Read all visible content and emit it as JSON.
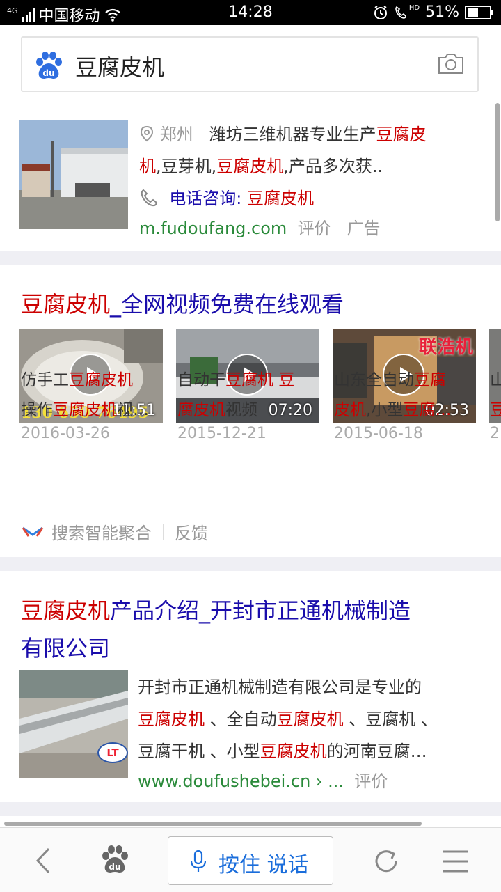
{
  "status_bar": {
    "network": "4G",
    "carrier": "中国移动",
    "time": "14:28",
    "hd": "HD",
    "battery": "51%",
    "battery_level": 0.51
  },
  "search": {
    "query": "豆腐皮机",
    "logo_text": "du"
  },
  "ad_card": {
    "location": "郑州",
    "desc_line1_plain": "潍坊三维机器专业生产",
    "desc_line1_red": "豆腐皮",
    "desc_line2_red1": "机",
    "desc_line2_plain1": ",豆芽机,",
    "desc_line2_red2": "豆腐皮机",
    "desc_line2_plain2": ",产品多次获..",
    "phone_label": "电话咨询:",
    "phone_keyword": "豆腐皮机",
    "url": "m.fudoufang.com",
    "rate": "评价",
    "ad_tag": "广告"
  },
  "video_card": {
    "title_red": "豆腐皮机",
    "title_rest": "_全网视频免费在线观看",
    "videos": [
      {
        "duration": "11:51",
        "t1a": "仿手工",
        "t1b": "豆腐皮机",
        "t2a": "操作",
        "t2b": "豆腐皮机",
        "t2c": "视…",
        "date": "2016-03-26",
        "overlay": "130 650 76495"
      },
      {
        "duration": "07:20",
        "t1a": "自动干",
        "t1b": "豆腐机 豆",
        "t2a": "",
        "t2b": "腐皮机",
        "t2c": "视频",
        "date": "2015-12-21"
      },
      {
        "duration": "02:53",
        "t1a": "山东全自动",
        "t1b": "豆腐",
        "t2a": "",
        "t2b": "皮机",
        "t2c": ",小型",
        "t2d": "豆腐…",
        "date": "2015-06-18",
        "overlay": "联浩机"
      }
    ],
    "peek": {
      "t1": "山",
      "t2": "豆",
      "date": "2"
    },
    "smart": "搜索智能聚合",
    "feedback": "反馈"
  },
  "result_card": {
    "title_red": "豆腐皮机",
    "title_rest1": "产品介绍_开封市正通机械制造",
    "title_rest2": "有限公司",
    "d1": "开封市正通机械制造有限公司是专业的",
    "d2a": "豆腐皮机",
    "d2b": " 、全自动",
    "d2c": "豆腐皮机",
    "d2d": " 、豆腐机 、",
    "d3a": "豆腐干机 、小型",
    "d3b": "豆腐皮机",
    "d3c": "的河南豆腐…",
    "url": "www.doufushebei.cn › ...",
    "rate": "评价",
    "thumb_logo": "LT"
  },
  "bottom": {
    "voice_label": "按住 说话"
  }
}
